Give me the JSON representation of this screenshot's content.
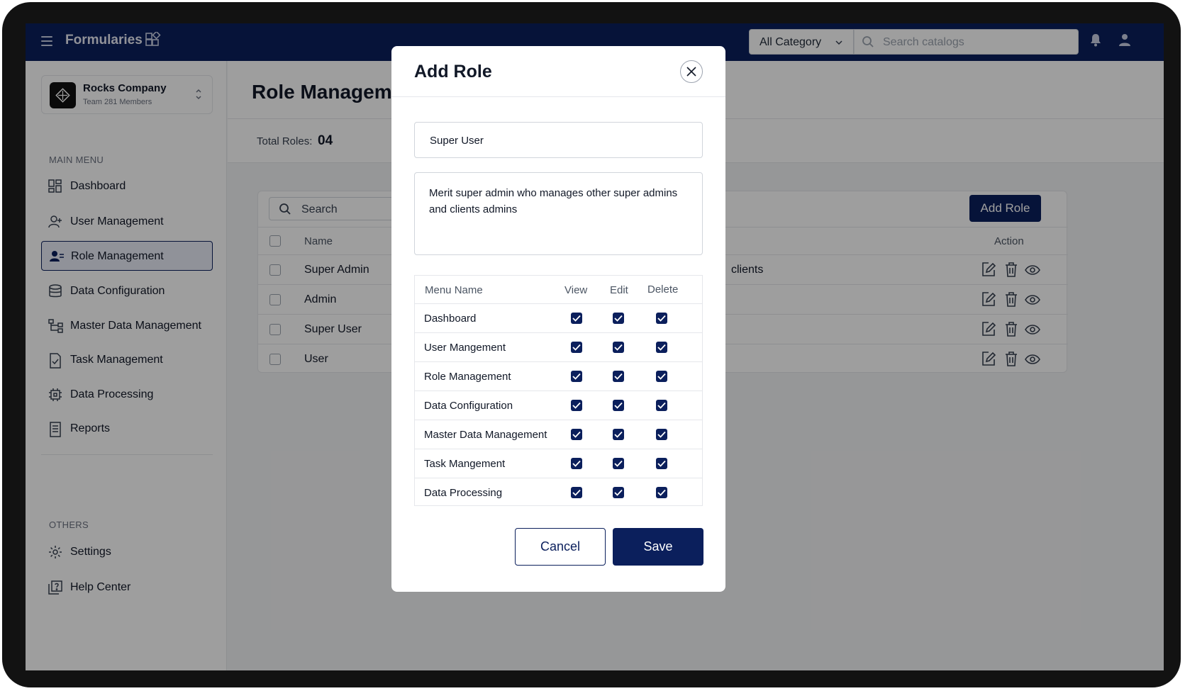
{
  "app": {
    "title": "Formularies"
  },
  "topbar": {
    "category_label": "All Category",
    "search_placeholder": "Search catalogs"
  },
  "company": {
    "name": "Rocks Company",
    "subtitle": "Team 281 Members"
  },
  "sidebar": {
    "main_label": "MAIN MENU",
    "items": [
      {
        "label": "Dashboard",
        "icon": "dashboard-icon"
      },
      {
        "label": "User Management",
        "icon": "users-icon"
      },
      {
        "label": "Role Management",
        "icon": "role-icon",
        "active": true
      },
      {
        "label": "Data Configuration",
        "icon": "database-icon"
      },
      {
        "label": "Master Data Management",
        "icon": "hierarchy-icon"
      },
      {
        "label": "Task Management",
        "icon": "task-icon"
      },
      {
        "label": "Data Processing",
        "icon": "chip-icon"
      },
      {
        "label": "Reports",
        "icon": "report-icon"
      }
    ],
    "others_label": "OTHERS",
    "others": [
      {
        "label": "Settings",
        "icon": "gear-icon"
      },
      {
        "label": "Help Center",
        "icon": "help-icon"
      }
    ]
  },
  "main": {
    "page_title": "Role Management",
    "total_label": "Total Roles:",
    "total_value": "04",
    "search_placeholder": "Search",
    "add_role_label": "Add Role",
    "col_name": "Name",
    "col_action": "Action",
    "rows": [
      {
        "name": "Super Admin",
        "desc_tail": "clients"
      },
      {
        "name": "Admin",
        "desc_tail": ""
      },
      {
        "name": "Super User",
        "desc_tail": ""
      },
      {
        "name": "User",
        "desc_tail": ""
      }
    ]
  },
  "modal": {
    "title": "Add Role",
    "role_name": "Super User",
    "role_description": "Merit super admin who manages other super admins and clients admins",
    "col_menu": "Menu Name",
    "col_view": "View",
    "col_edit": "Edit",
    "col_delete": "Delete",
    "permissions": [
      {
        "menu": "Dashboard",
        "view": true,
        "edit": true,
        "delete": true
      },
      {
        "menu": "User Mangement",
        "view": true,
        "edit": true,
        "delete": true
      },
      {
        "menu": "Role Management",
        "view": true,
        "edit": true,
        "delete": true
      },
      {
        "menu": "Data Configuration",
        "view": true,
        "edit": true,
        "delete": true
      },
      {
        "menu": "Master Data Management",
        "view": true,
        "edit": true,
        "delete": true
      },
      {
        "menu": "Task Mangement",
        "view": true,
        "edit": true,
        "delete": true
      },
      {
        "menu": "Data Processing",
        "view": true,
        "edit": true,
        "delete": true
      }
    ],
    "cancel_label": "Cancel",
    "save_label": "Save"
  },
  "colors": {
    "primary": "#0b1f5c",
    "overlay": "rgba(0,0,0,0.38)"
  }
}
